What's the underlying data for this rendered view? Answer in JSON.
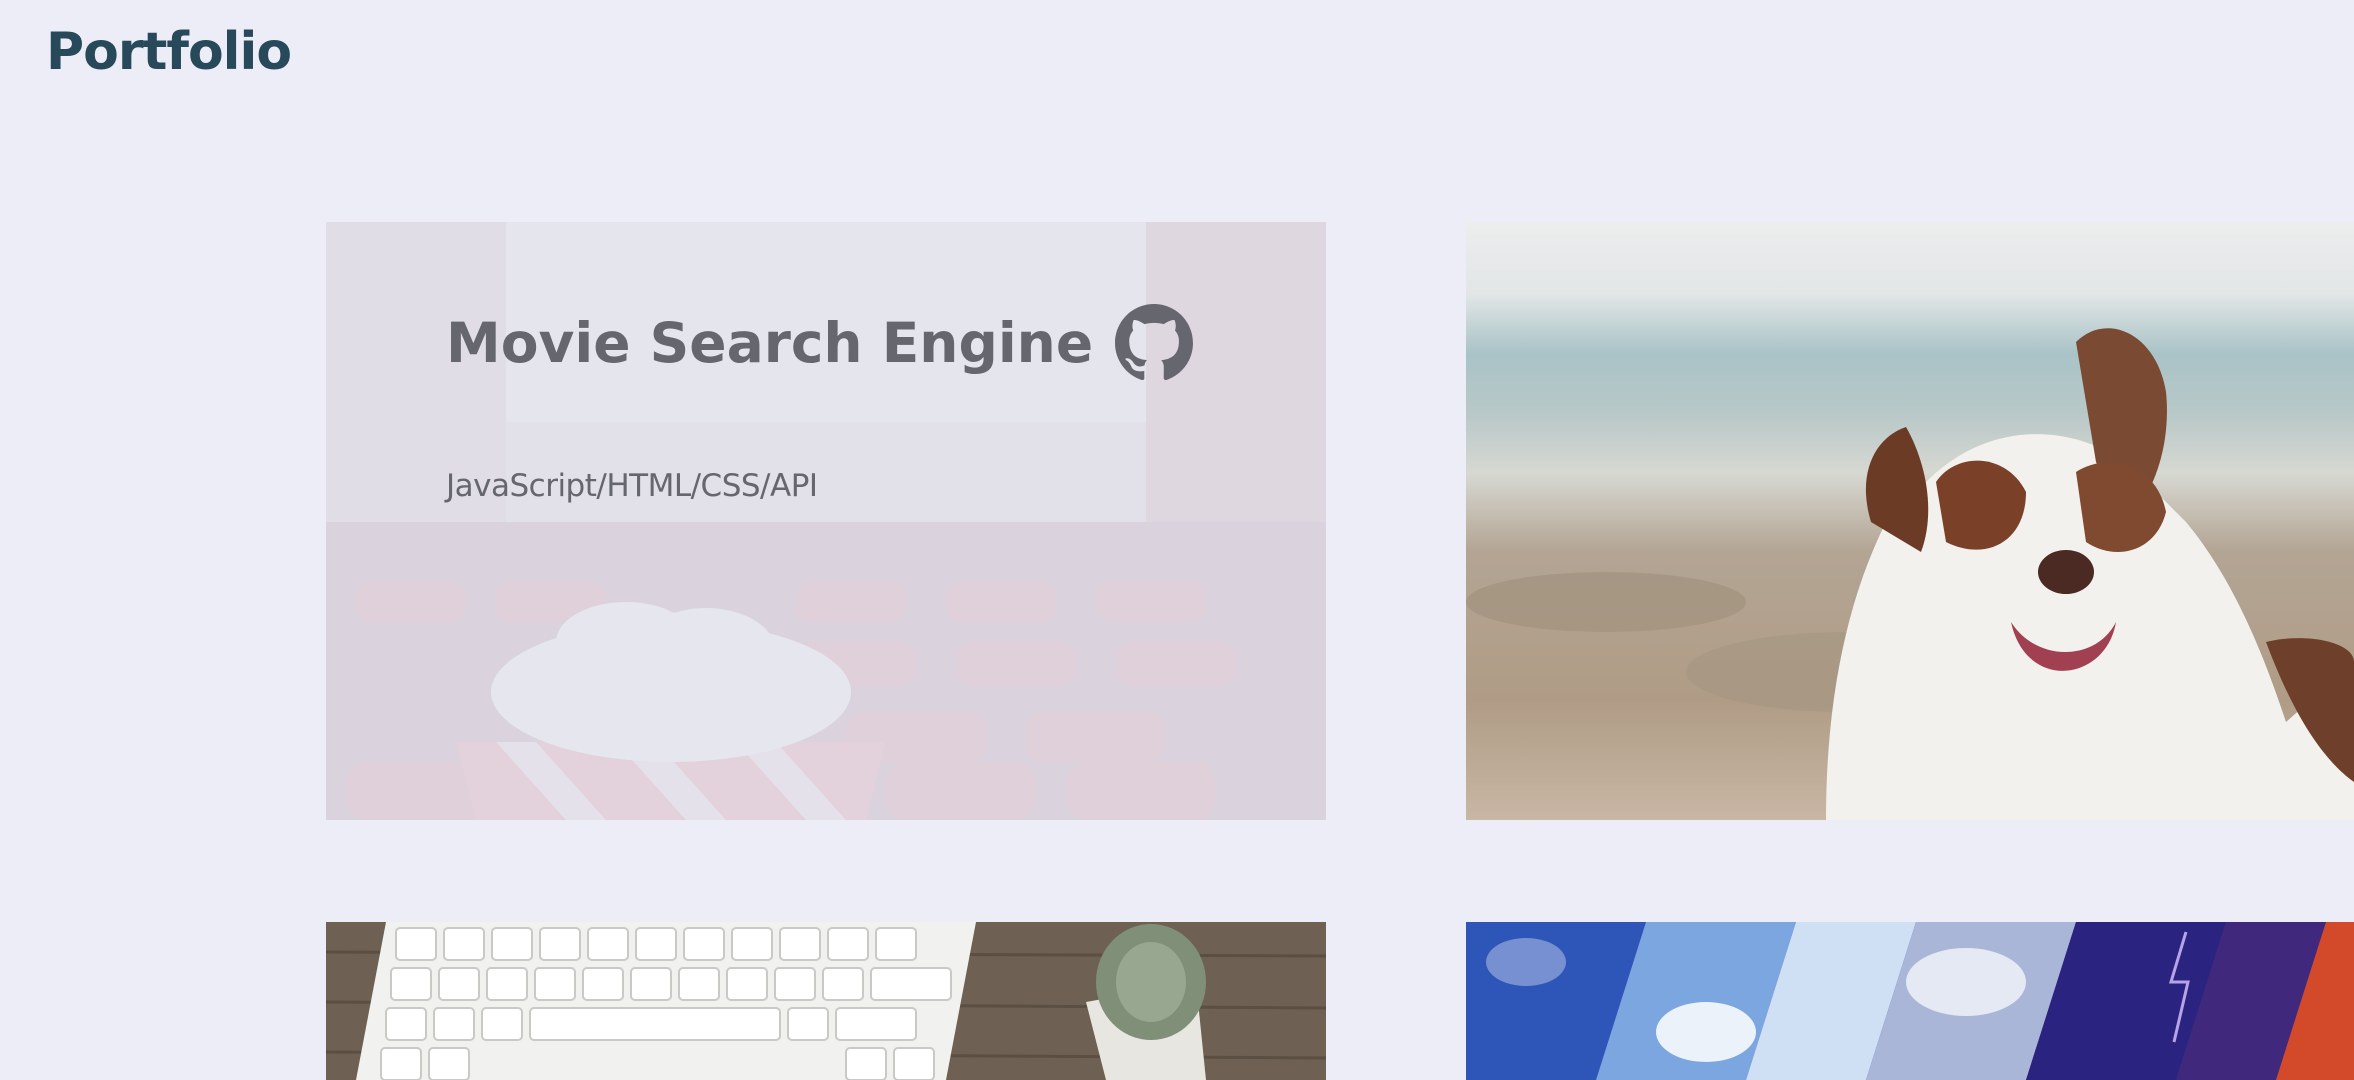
{
  "page": {
    "title": "Portfolio"
  },
  "projects": [
    {
      "title": "Movie Search Engine",
      "tech": "JavaScript/HTML/CSS/API",
      "icon": "github-icon"
    }
  ],
  "colors": {
    "background": "#ededf8",
    "title": "#27495a",
    "overlay_text": "#66666e"
  }
}
